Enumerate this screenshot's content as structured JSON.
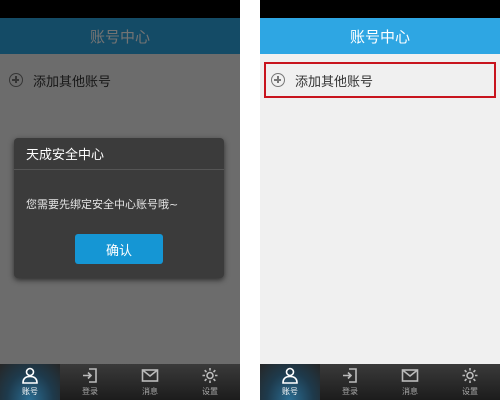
{
  "header": {
    "title": "账号中心"
  },
  "add_account": {
    "label": "添加其他账号"
  },
  "dialog": {
    "title": "天成安全中心",
    "message": "您需要先绑定安全中心账号哦~",
    "confirm_label": "确认"
  },
  "tabs": [
    {
      "label": "账号",
      "icon": "user-icon",
      "active": true
    },
    {
      "label": "登录",
      "icon": "login-icon",
      "active": false
    },
    {
      "label": "消息",
      "icon": "mail-icon",
      "active": false
    },
    {
      "label": "设置",
      "icon": "gear-icon",
      "active": false
    }
  ],
  "colors": {
    "titlebar": "#2ea6e3",
    "button": "#1596d4",
    "highlight_border": "#c8141e",
    "background": "#f0f0f0"
  }
}
